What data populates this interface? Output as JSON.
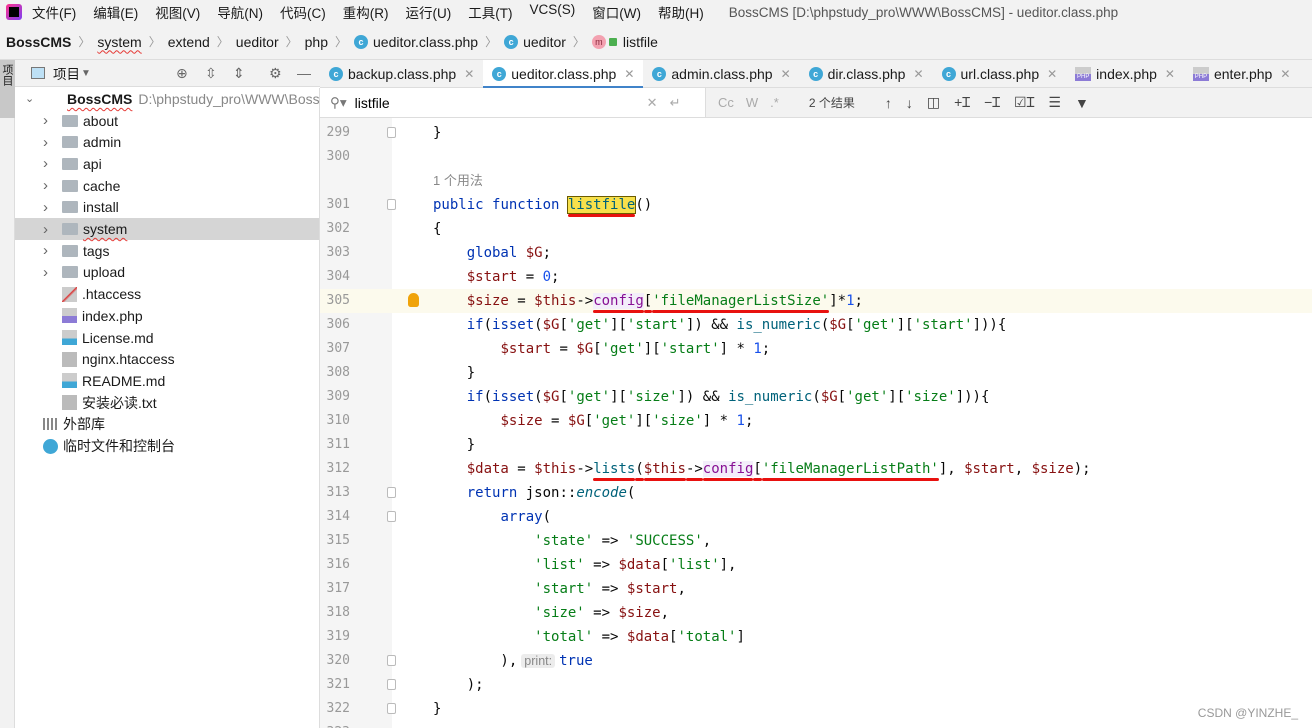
{
  "menu": {
    "items": [
      "文件(F)",
      "编辑(E)",
      "视图(V)",
      "导航(N)",
      "代码(C)",
      "重构(R)",
      "运行(U)",
      "工具(T)",
      "VCS(S)",
      "窗口(W)",
      "帮助(H)"
    ],
    "window_title": "BossCMS [D:\\phpstudy_pro\\WWW\\BossCMS] - ueditor.class.php"
  },
  "breadcrumb": [
    "BossCMS",
    "system",
    "extend",
    "ueditor",
    "php",
    "ueditor.class.php",
    "ueditor",
    "listfile"
  ],
  "sidebar": {
    "strip_label": "项目",
    "panel_title": "项目",
    "root": {
      "name": "BossCMS",
      "path": "D:\\phpstudy_pro\\WWW\\BossC"
    },
    "items": [
      {
        "label": "about",
        "type": "folder"
      },
      {
        "label": "admin",
        "type": "folder"
      },
      {
        "label": "api",
        "type": "folder"
      },
      {
        "label": "cache",
        "type": "folder"
      },
      {
        "label": "install",
        "type": "folder"
      },
      {
        "label": "system",
        "type": "folder",
        "selected": true
      },
      {
        "label": "tags",
        "type": "folder"
      },
      {
        "label": "upload",
        "type": "folder"
      },
      {
        "label": ".htaccess",
        "type": "ht"
      },
      {
        "label": "index.php",
        "type": "php"
      },
      {
        "label": "License.md",
        "type": "md"
      },
      {
        "label": "nginx.htaccess",
        "type": "txt"
      },
      {
        "label": "README.md",
        "type": "md"
      },
      {
        "label": "安装必读.txt",
        "type": "txt"
      }
    ],
    "external": "外部库",
    "scratches": "临时文件和控制台"
  },
  "tabs": [
    {
      "label": "backup.class.php",
      "icon": "class"
    },
    {
      "label": "ueditor.class.php",
      "icon": "class",
      "active": true
    },
    {
      "label": "admin.class.php",
      "icon": "class"
    },
    {
      "label": "dir.class.php",
      "icon": "class"
    },
    {
      "label": "url.class.php",
      "icon": "class"
    },
    {
      "label": "index.php",
      "icon": "php"
    },
    {
      "label": "enter.php",
      "icon": "php"
    }
  ],
  "search": {
    "value": "listfile",
    "results": "2 个结果",
    "opts": [
      "Cc",
      "W",
      ".*"
    ]
  },
  "editor": {
    "usage_hint": "1 个用法",
    "inlay_print": "print:",
    "lines": [
      {
        "n": "299",
        "t": [
          [
            "p",
            "}"
          ]
        ]
      },
      {
        "n": "300",
        "t": []
      },
      {
        "hint": true
      },
      {
        "n": "301",
        "t": [
          [
            "k",
            "public "
          ],
          [
            "k",
            "function "
          ],
          [
            "hl",
            "listfile"
          ],
          [
            "p",
            "()"
          ]
        ]
      },
      {
        "n": "302",
        "t": [
          [
            "p",
            "{"
          ]
        ]
      },
      {
        "n": "303",
        "t": [
          [
            "p",
            "    "
          ],
          [
            "k",
            "global "
          ],
          [
            "v",
            "$G"
          ],
          [
            "p",
            ";"
          ]
        ]
      },
      {
        "n": "304",
        "t": [
          [
            "p",
            "    "
          ],
          [
            "v",
            "$start"
          ],
          [
            "p",
            " = "
          ],
          [
            "n",
            "0"
          ],
          [
            "p",
            ";"
          ]
        ]
      },
      {
        "n": "305",
        "cur": true,
        "t": [
          [
            "p",
            "    "
          ],
          [
            "v",
            "$size"
          ],
          [
            "p",
            " = "
          ],
          [
            "v",
            "$this"
          ],
          [
            "p",
            "->"
          ],
          [
            "m",
            "config",
            "u"
          ],
          [
            "p",
            "[",
            "u"
          ],
          [
            "s",
            "'fileManagerListSize'",
            "u"
          ],
          [
            "p",
            "]*"
          ],
          [
            "n",
            "1"
          ],
          [
            "p",
            ";"
          ]
        ]
      },
      {
        "n": "306",
        "t": [
          [
            "p",
            "    "
          ],
          [
            "k",
            "if"
          ],
          [
            "p",
            "("
          ],
          [
            "k",
            "isset"
          ],
          [
            "p",
            "("
          ],
          [
            "v",
            "$G"
          ],
          [
            "p",
            "["
          ],
          [
            "s",
            "'get'"
          ],
          [
            "p",
            "]["
          ],
          [
            "s",
            "'start'"
          ],
          [
            "p",
            "]) && "
          ],
          [
            "f",
            "is_numeric"
          ],
          [
            "p",
            "("
          ],
          [
            "v",
            "$G"
          ],
          [
            "p",
            "["
          ],
          [
            "s",
            "'get'"
          ],
          [
            "p",
            "]["
          ],
          [
            "s",
            "'start'"
          ],
          [
            "p",
            "])){"
          ]
        ]
      },
      {
        "n": "307",
        "t": [
          [
            "p",
            "        "
          ],
          [
            "v",
            "$start"
          ],
          [
            "p",
            " = "
          ],
          [
            "v",
            "$G"
          ],
          [
            "p",
            "["
          ],
          [
            "s",
            "'get'"
          ],
          [
            "p",
            "]["
          ],
          [
            "s",
            "'start'"
          ],
          [
            "p",
            "] * "
          ],
          [
            "n",
            "1"
          ],
          [
            "p",
            ";"
          ]
        ]
      },
      {
        "n": "308",
        "t": [
          [
            "p",
            "    }"
          ]
        ]
      },
      {
        "n": "309",
        "t": [
          [
            "p",
            "    "
          ],
          [
            "k",
            "if"
          ],
          [
            "p",
            "("
          ],
          [
            "k",
            "isset"
          ],
          [
            "p",
            "("
          ],
          [
            "v",
            "$G"
          ],
          [
            "p",
            "["
          ],
          [
            "s",
            "'get'"
          ],
          [
            "p",
            "]["
          ],
          [
            "s",
            "'size'"
          ],
          [
            "p",
            "]) && "
          ],
          [
            "f",
            "is_numeric"
          ],
          [
            "p",
            "("
          ],
          [
            "v",
            "$G"
          ],
          [
            "p",
            "["
          ],
          [
            "s",
            "'get'"
          ],
          [
            "p",
            "]["
          ],
          [
            "s",
            "'size'"
          ],
          [
            "p",
            "])){"
          ]
        ]
      },
      {
        "n": "310",
        "t": [
          [
            "p",
            "        "
          ],
          [
            "v",
            "$size"
          ],
          [
            "p",
            " = "
          ],
          [
            "v",
            "$G"
          ],
          [
            "p",
            "["
          ],
          [
            "s",
            "'get'"
          ],
          [
            "p",
            "]["
          ],
          [
            "s",
            "'size'"
          ],
          [
            "p",
            "] * "
          ],
          [
            "n",
            "1"
          ],
          [
            "p",
            ";"
          ]
        ]
      },
      {
        "n": "311",
        "t": [
          [
            "p",
            "    }"
          ]
        ]
      },
      {
        "n": "312",
        "t": [
          [
            "p",
            "    "
          ],
          [
            "v",
            "$data"
          ],
          [
            "p",
            " = "
          ],
          [
            "v",
            "$this"
          ],
          [
            "p",
            "->"
          ],
          [
            "f",
            "lists",
            "u"
          ],
          [
            "p",
            "(",
            "u"
          ],
          [
            "v",
            "$this",
            "u"
          ],
          [
            "p",
            "->",
            "u"
          ],
          [
            "m",
            "config",
            "u"
          ],
          [
            "p",
            "[",
            "u"
          ],
          [
            "s",
            "'fileManagerListPath'",
            "u"
          ],
          [
            "p",
            "], "
          ],
          [
            "v",
            "$start"
          ],
          [
            "p",
            ", "
          ],
          [
            "v",
            "$size"
          ],
          [
            "p",
            ");"
          ]
        ]
      },
      {
        "n": "313",
        "t": [
          [
            "p",
            "    "
          ],
          [
            "k",
            "return "
          ],
          [
            "p",
            "json::"
          ],
          [
            "i",
            "encode"
          ],
          [
            "p",
            "("
          ]
        ]
      },
      {
        "n": "314",
        "t": [
          [
            "p",
            "        "
          ],
          [
            "k",
            "array"
          ],
          [
            "p",
            "("
          ]
        ]
      },
      {
        "n": "315",
        "t": [
          [
            "p",
            "            "
          ],
          [
            "s",
            "'state'"
          ],
          [
            "p",
            " => "
          ],
          [
            "s",
            "'SUCCESS'"
          ],
          [
            "p",
            ","
          ]
        ]
      },
      {
        "n": "316",
        "t": [
          [
            "p",
            "            "
          ],
          [
            "s",
            "'list'"
          ],
          [
            "p",
            " => "
          ],
          [
            "v",
            "$data"
          ],
          [
            "p",
            "["
          ],
          [
            "s",
            "'list'"
          ],
          [
            "p",
            "],"
          ]
        ]
      },
      {
        "n": "317",
        "t": [
          [
            "p",
            "            "
          ],
          [
            "s",
            "'start'"
          ],
          [
            "p",
            " => "
          ],
          [
            "v",
            "$start"
          ],
          [
            "p",
            ","
          ]
        ]
      },
      {
        "n": "318",
        "t": [
          [
            "p",
            "            "
          ],
          [
            "s",
            "'size'"
          ],
          [
            "p",
            " => "
          ],
          [
            "v",
            "$size"
          ],
          [
            "p",
            ","
          ]
        ]
      },
      {
        "n": "319",
        "t": [
          [
            "p",
            "            "
          ],
          [
            "s",
            "'total'"
          ],
          [
            "p",
            " => "
          ],
          [
            "v",
            "$data"
          ],
          [
            "p",
            "["
          ],
          [
            "s",
            "'total'"
          ],
          [
            "p",
            "]"
          ]
        ]
      },
      {
        "n": "320",
        "t": [
          [
            "p",
            "        ),"
          ],
          [
            "inlay",
            "print:"
          ],
          [
            "k",
            "true"
          ]
        ]
      },
      {
        "n": "321",
        "t": [
          [
            "p",
            "    );"
          ]
        ]
      },
      {
        "n": "322",
        "t": [
          [
            "p",
            "}"
          ]
        ]
      },
      {
        "n": "323",
        "t": []
      }
    ]
  },
  "watermark": "CSDN @YINZHE_"
}
